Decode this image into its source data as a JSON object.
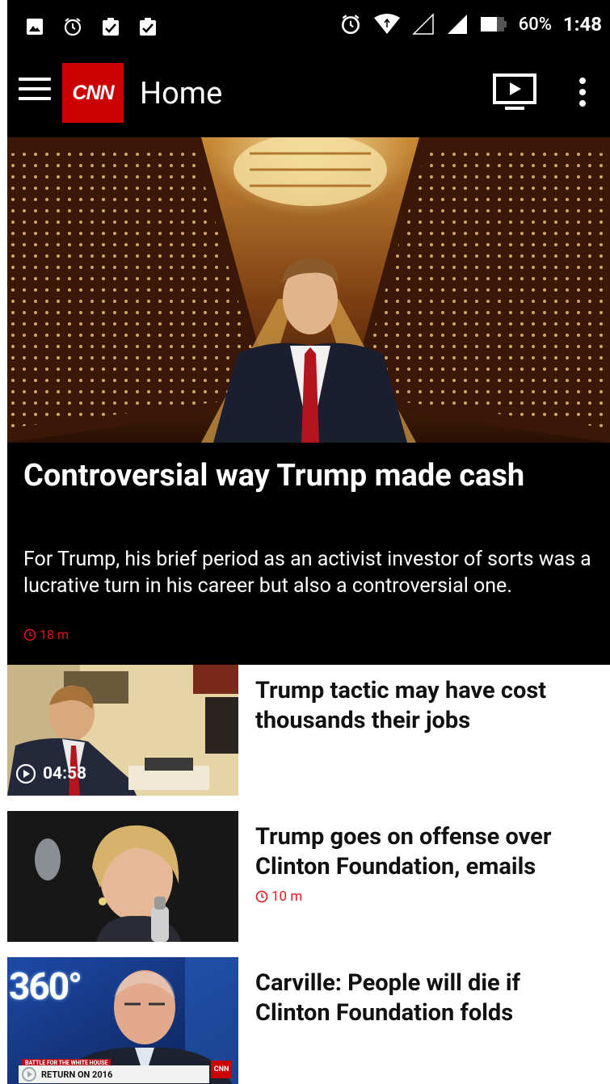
{
  "status_bar": {
    "battery": "60%",
    "time": "1:48"
  },
  "app_bar": {
    "logo_text": "CNN",
    "title": "Home"
  },
  "hero": {
    "headline": "Controversial way Trump made cash",
    "description": "For Trump, his brief period as an activist investor of sorts was a lucrative turn in his career but also a controversial one.",
    "time": "18 m"
  },
  "stories": [
    {
      "title": "Trump tactic may have cost thousands their jobs",
      "video_duration": "04:58"
    },
    {
      "title": "Trump goes on offense over Clinton Foundation, emails",
      "time": "10 m"
    },
    {
      "title": "Carville: People will die if Clinton Foundation folds",
      "thumb_brand": "360°",
      "thumb_ticker": "BATTLE FOR THE WHITE HOUSE",
      "thumb_caption": "RETURN ON 2016"
    }
  ],
  "colors": {
    "brand_red": "#cc0000",
    "time_red": "#e0161d",
    "bar_bg": "#000000"
  }
}
